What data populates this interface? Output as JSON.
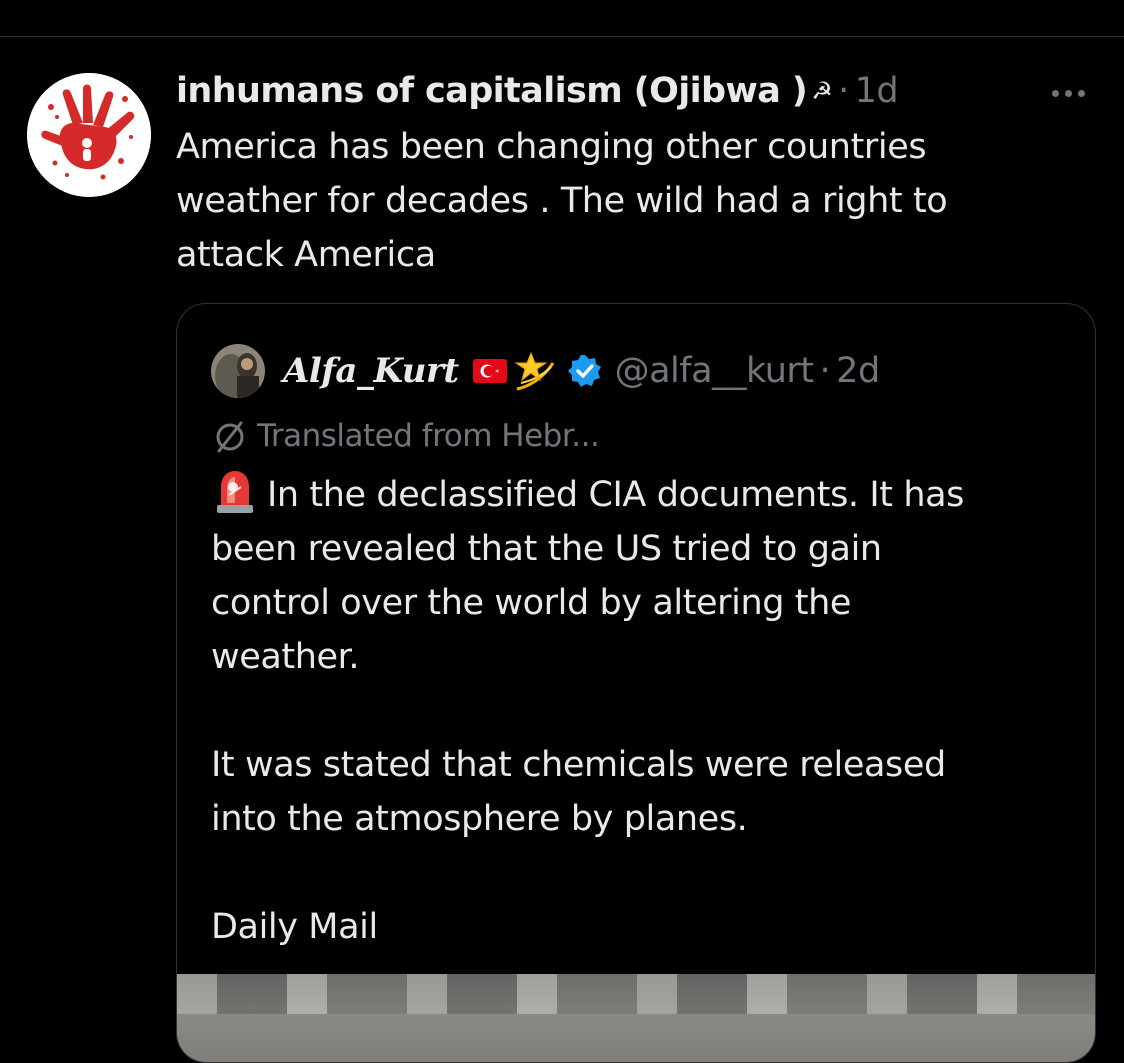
{
  "author": {
    "display_name": "inhumans of capitalism (Ojibwa )",
    "name_symbol": "☭",
    "separator": "·",
    "time": "1d"
  },
  "tweet": {
    "text": "America has been  changing other countries\nweather for decades . The wild had a right to\nattack America"
  },
  "quote": {
    "display_name": "Alfa_Kurt",
    "flag_icon": "turkey-flag-icon",
    "emoji_icon": "dizzy-star-icon",
    "verified_color": "#1d9bf0",
    "handle": "@alfa__kurt",
    "separator": "·",
    "time": "2d",
    "translated_label": "Translated from Hebr...",
    "paragraph_1": "In the declassified CIA documents. It has\nbeen revealed that the US tried to gain\ncontrol over the world by altering the\nweather.",
    "paragraph_2": "It was stated that chemicals were released\ninto the atmosphere by planes.",
    "paragraph_3": "Daily Mail",
    "siren_icon": "police-light-icon"
  },
  "colors": {
    "background": "#000000",
    "text": "#e7e9ea",
    "muted": "#71767b",
    "border": "#2f3336",
    "logo_red": "#d42a2a"
  }
}
